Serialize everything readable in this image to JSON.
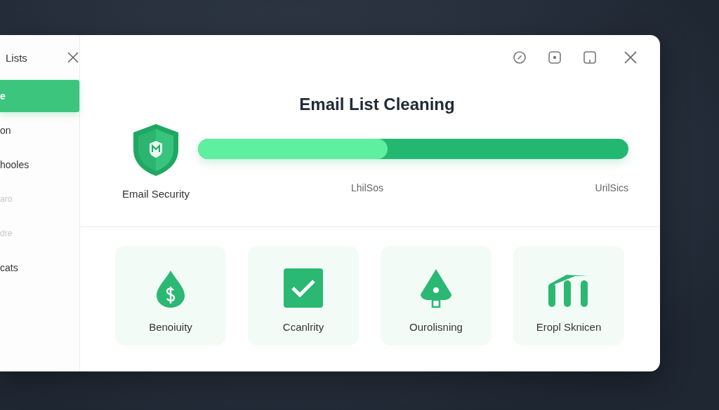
{
  "sidebar": {
    "title": "Lists",
    "items": [
      {
        "label": "e",
        "selected": true,
        "disabled": false
      },
      {
        "label": "on",
        "selected": false,
        "disabled": false
      },
      {
        "label": "hooles",
        "selected": false,
        "disabled": false
      },
      {
        "label": "aro",
        "selected": false,
        "disabled": true
      },
      {
        "label": "dre",
        "selected": false,
        "disabled": true
      },
      {
        "label": "cats",
        "selected": false,
        "disabled": false
      }
    ]
  },
  "main": {
    "title": "Email List Cleaning",
    "security": {
      "label": "Email Security"
    },
    "progress": {
      "level": 0.44,
      "labels": [
        "LhilSos",
        "UrilSics"
      ]
    },
    "cards": [
      {
        "kind": "drop",
        "label": "Benoiuity"
      },
      {
        "kind": "check",
        "label": "Ccanlrity"
      },
      {
        "kind": "tree",
        "label": "Ourolisning"
      },
      {
        "kind": "bars",
        "label": "Eropl Sknicen"
      }
    ]
  }
}
